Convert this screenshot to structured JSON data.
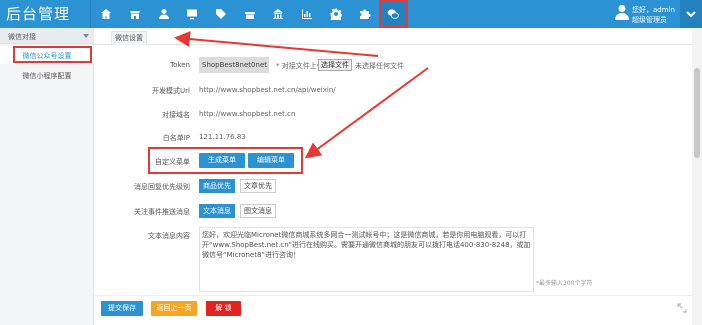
{
  "brand": "后台管理",
  "nav_icons": [
    "home-icon",
    "store-icon",
    "user-icon",
    "monitor-icon",
    "tag-icon",
    "gift-icon",
    "building-icon",
    "chart-icon",
    "gear-icon",
    "puzzle-icon",
    "wechat-icon"
  ],
  "user": {
    "greeting": "您好，admin",
    "role": "超级管理员"
  },
  "sidebar": {
    "group": "微信对接",
    "items": [
      {
        "label": "微信公众号设置"
      },
      {
        "label": "微信小程序配置"
      }
    ]
  },
  "tab": "微信设置",
  "form": {
    "token": {
      "label": "Token",
      "value": "ShopBest8net0net",
      "hint": "* 对接文件上传",
      "file_button": "选择文件",
      "file_status": "未选择任何文件"
    },
    "dev_url": {
      "label": "开发模式Url",
      "value": "http://www.shopbest.net.cn/api/weixin/"
    },
    "domain": {
      "label": "对接域名",
      "value": "http://www.shopbest.net.cn"
    },
    "whitelist": {
      "label": "白名单IP",
      "value": "121.11.76.83"
    },
    "custom_menu": {
      "label": "自定义菜单",
      "generate": "生成菜单",
      "edit": "编辑菜单"
    },
    "priority": {
      "label": "消息回复优先级别",
      "options": [
        "商品优先",
        "文章优先"
      ],
      "selected": "商品优先"
    },
    "follow": {
      "label": "关注事件推送消息",
      "options": [
        "文本消息",
        "图文消息"
      ],
      "selected": "文本消息"
    },
    "text_msg": {
      "label": "文本消息内容",
      "value": "您好，欢迎光临Micronet微信商城系统多网合一测试帐号中；这是微信商城，若是你用电脑观看，可以打开“www.ShopBest.net.cn”进行在线购买。需要开通微信商城的朋友可以拨打电话400-830-8248，或加微信号“Micronet8”进行咨询！",
      "limit": "*最多输入300个字符"
    }
  },
  "footer": {
    "save": "提交保存",
    "back": "返回上一页",
    "unlock": "解 锁"
  },
  "colors": {
    "primary": "#2b93d4",
    "highlight": "#e53935",
    "orange": "#f5a623",
    "red": "#e52222"
  }
}
